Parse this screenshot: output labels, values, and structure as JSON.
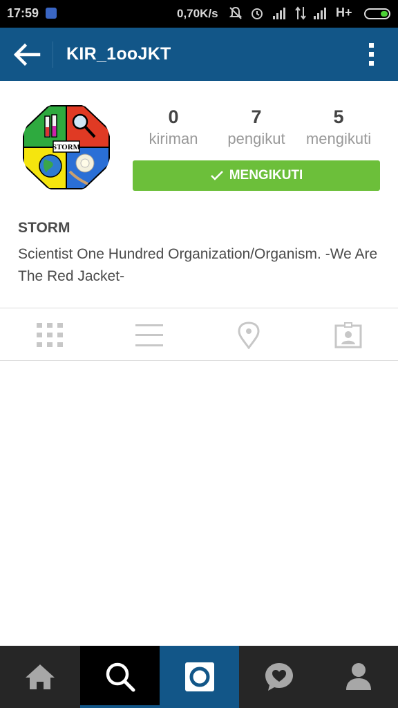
{
  "status_bar": {
    "time": "17:59",
    "network_speed": "0,70K/s",
    "network_type": "H+",
    "icons": [
      "bbm-icon",
      "mute-icon",
      "alarm-icon",
      "signal-icon",
      "data-arrows-icon",
      "signal-icon",
      "battery-icon"
    ]
  },
  "app_bar": {
    "title": "KIR_1ooJKT",
    "back_icon": "back-arrow-icon",
    "menu_icon": "more-vertical-icon"
  },
  "profile": {
    "avatar_text": "STORM",
    "stats": [
      {
        "value": "0",
        "label": "kiriman"
      },
      {
        "value": "7",
        "label": "pengikut"
      },
      {
        "value": "5",
        "label": "mengikuti"
      }
    ],
    "follow_button": "MENGIKUTI",
    "name": "STORM",
    "bio": "Scientist One Hundred Organization/Organism. -We Are The Red Jacket-"
  },
  "view_tabs": [
    "grid-icon",
    "list-icon",
    "location-pin-icon",
    "tagged-photo-icon"
  ],
  "bottom_nav": {
    "items": [
      "home-icon",
      "search-icon",
      "camera-icon",
      "activity-heart-icon",
      "profile-icon"
    ],
    "active": "search-icon"
  },
  "colors": {
    "app_bar": "#125688",
    "follow_button": "#6cbf3a",
    "bottom_nav": "#262626"
  }
}
